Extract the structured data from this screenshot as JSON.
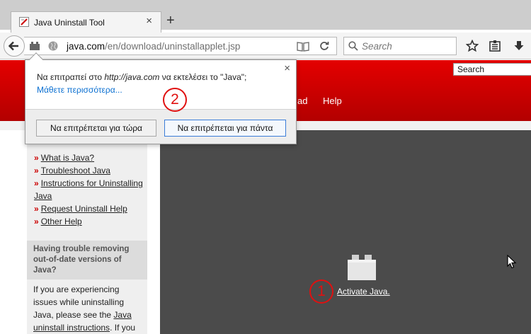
{
  "browser": {
    "tab": {
      "title": "Java Uninstall Tool",
      "close_glyph": "×"
    },
    "new_tab_glyph": "+",
    "url": {
      "host": "java.com",
      "path": "/en/download/uninstallapplet.jsp"
    },
    "search_placeholder": "Search"
  },
  "page": {
    "search_value": "Search",
    "nav": {
      "item_partial": "ad",
      "help": "Help"
    },
    "sidebar_links": [
      {
        "arrow": "»",
        "text": "What is Java?"
      },
      {
        "arrow": "»",
        "text": "Troubleshoot Java"
      },
      {
        "arrow": "»",
        "text": "Instructions for Uninstalling Java"
      },
      {
        "arrow": "»",
        "text": "Request Uninstall Help"
      },
      {
        "arrow": "»",
        "text": "Other Help"
      }
    ],
    "trouble_heading": "Having trouble removing out-of-date versions of Java?",
    "trouble_text_1": "If you are experiencing issues while uninstalling Java, please see the ",
    "trouble_link": "Java uninstall instructions",
    "trouble_text_2": ". If you",
    "activate_label": "Activate Java."
  },
  "doorhanger": {
    "message_prefix": "Να επιτραπεί στο ",
    "message_site": "http://java.com",
    "message_suffix": " να εκτελέσει το \"Java\";",
    "learn_more": "Μάθετε περισσότερα...",
    "close_glyph": "×",
    "allow_now": "Να επιτρέπεται για τώρα",
    "allow_always": "Να επιτρέπεται για πάντα"
  },
  "annotations": {
    "step1": "1",
    "step2": "2"
  },
  "colors": {
    "java_red": "#cc0000",
    "annotation_red": "#e01010",
    "panel_dark": "#4b4b4b",
    "link_blue": "#0a6fd1"
  }
}
